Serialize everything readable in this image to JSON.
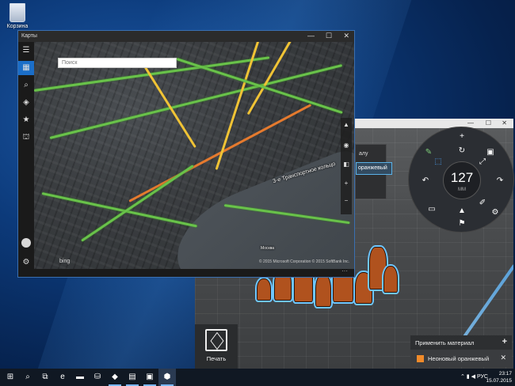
{
  "desktop": {
    "recycle_bin_label": "Корзина"
  },
  "maps": {
    "title": "Карты",
    "search_placeholder": "Поиск",
    "labels": {
      "third_ring": "3-е Транспортное кольцо",
      "river": "Москва"
    },
    "bing": "bing",
    "copyright": "© 2015 Microsoft Corporation   © 2015 SoftBank Inc.",
    "rail_icons": [
      "menu-icon",
      "map-icon",
      "search-icon",
      "directions-icon",
      "favorites-icon",
      "3d-city-icon",
      "avatar",
      "settings-icon"
    ]
  },
  "builder": {
    "dropdown_label": "алу",
    "dropdown_selected": "оранжевый",
    "wheel": {
      "value": "127",
      "unit": "ММ"
    },
    "material_panel": {
      "header": "Применить материал",
      "item": "Неоновый оранжевый",
      "item_color": "#f08a2a"
    },
    "print_label": "Печать"
  },
  "taskbar": {
    "lang": "РУС",
    "time": "23:17",
    "date": "15.07.2015"
  },
  "colors": {
    "accent": "#1b6ec8",
    "roads_green": "#69c24a",
    "roads_yellow": "#f0c335",
    "selection": "#6fc7ff"
  }
}
